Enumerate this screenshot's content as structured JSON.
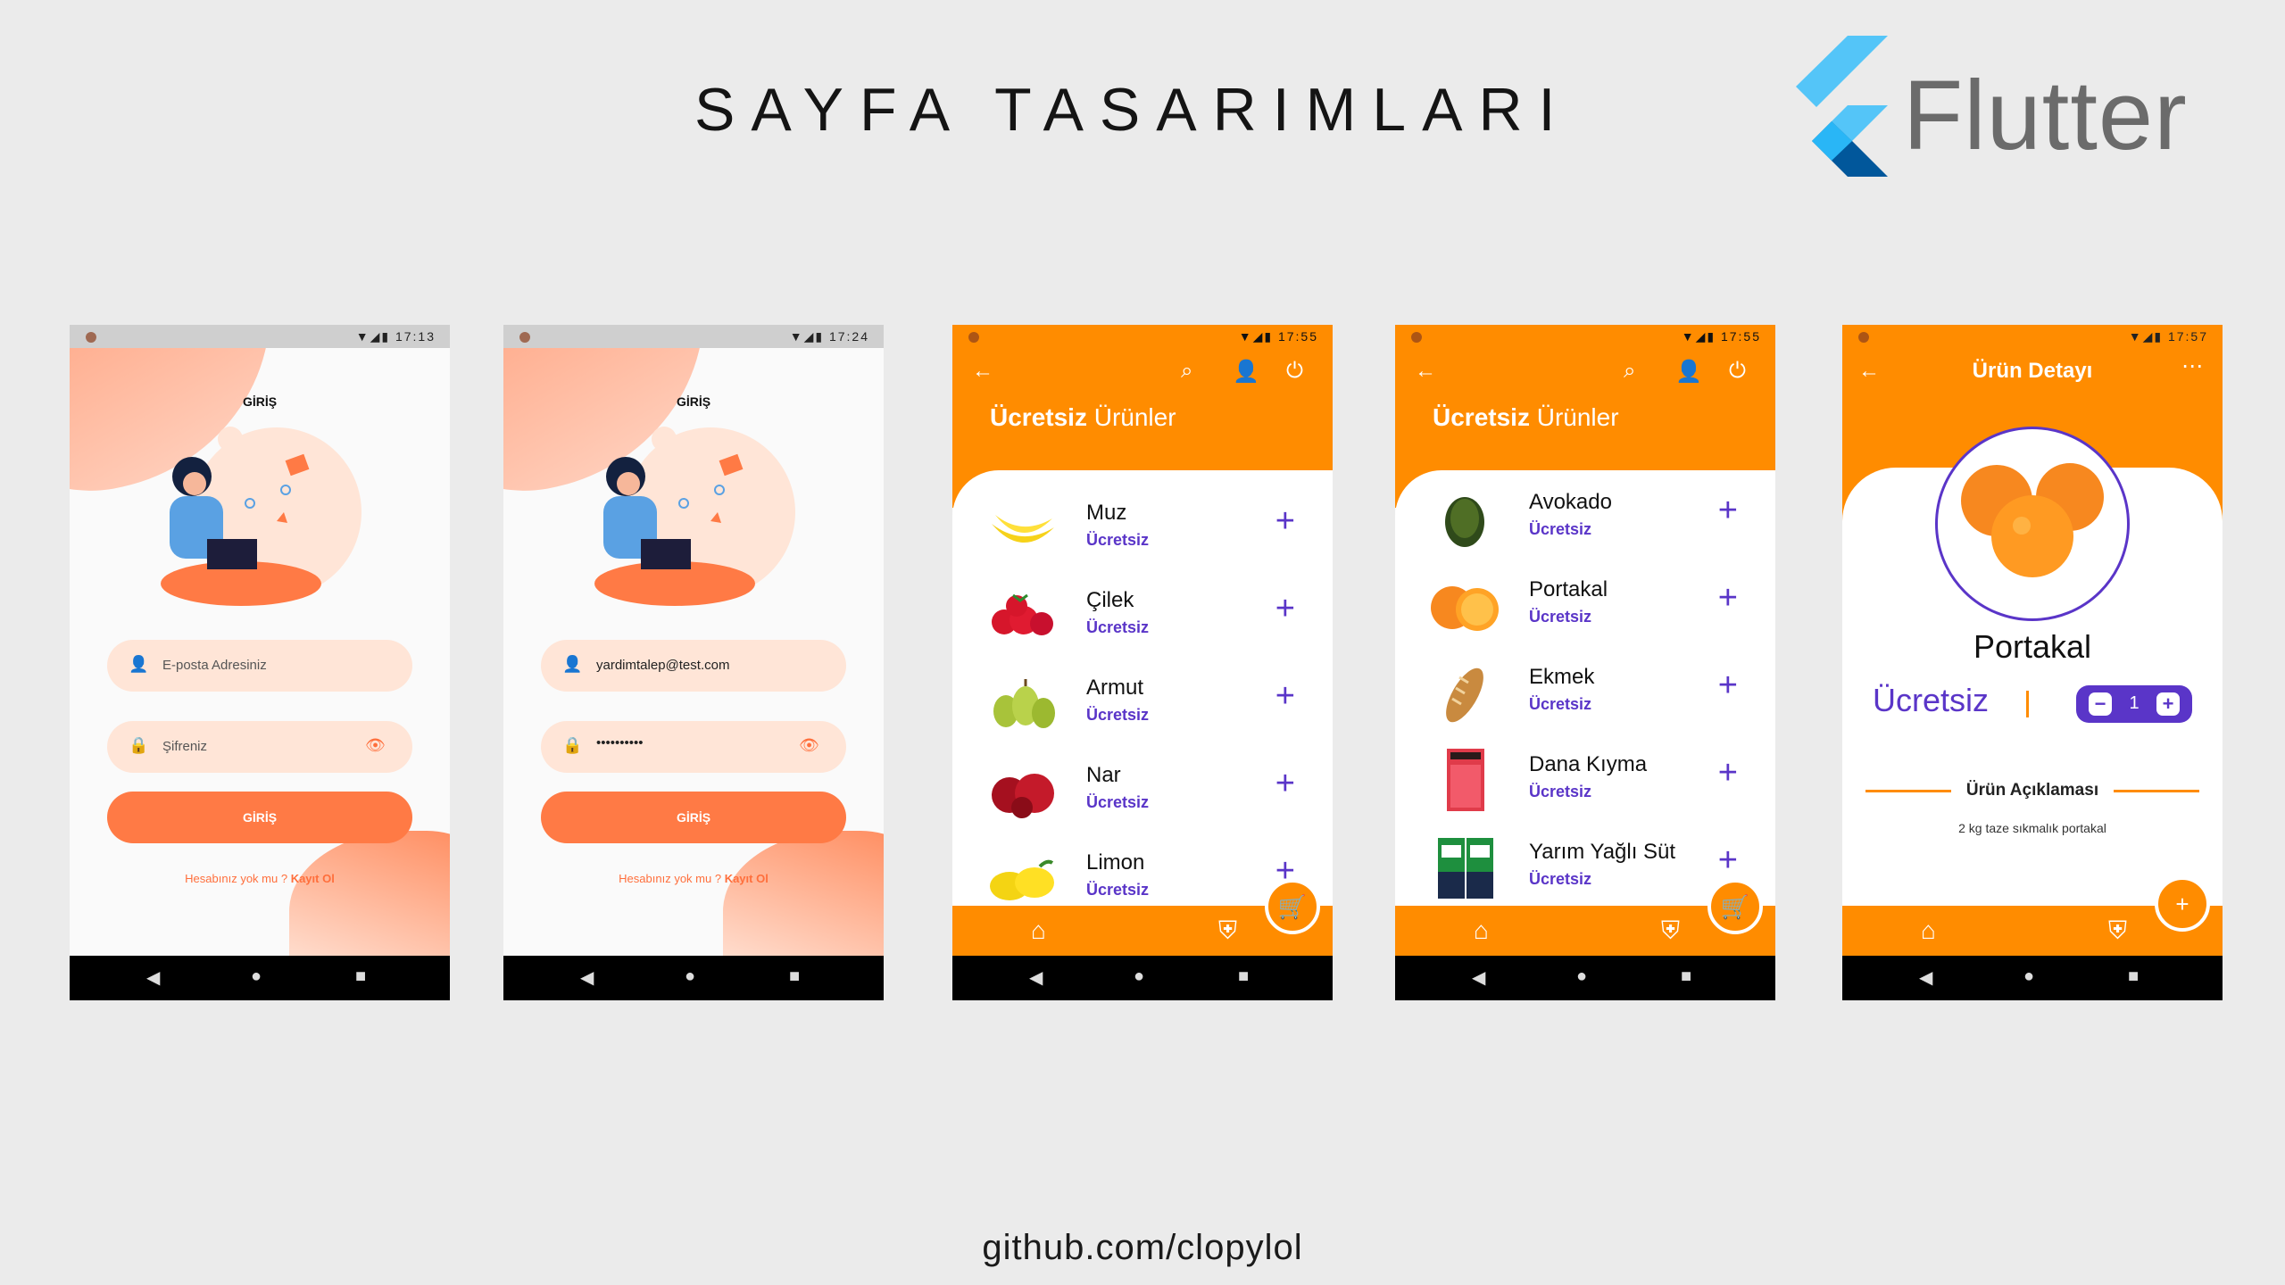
{
  "page_title": "SAYFA TASARIMLARI",
  "flutter_word": "Flutter",
  "footer_link": "github.com/clopylol",
  "colors": {
    "orange": "#ff8c00",
    "purple": "#5a35c8",
    "login_accent": "#ff7a45"
  },
  "login1": {
    "time": "17:13",
    "title": "GİRİŞ",
    "email_placeholder": "E-posta Adresiniz",
    "password_placeholder": "Şifreniz",
    "button": "GİRİŞ",
    "signup_prefix": "Hesabınız yok mu ?",
    "signup_link": "Kayıt Ol"
  },
  "login2": {
    "time": "17:24",
    "title": "GİRİŞ",
    "email_value": "yardimtalep@test.com",
    "password_value": "••••••••••",
    "button": "GİRİŞ",
    "signup_prefix": "Hesabınız yok mu ?",
    "signup_link": "Kayıt Ol"
  },
  "list1": {
    "time": "17:55",
    "title_bold": "Ücretsiz",
    "title_rest": "Ürünler",
    "items": [
      {
        "name": "Muz",
        "price": "Ücretsiz"
      },
      {
        "name": "Çilek",
        "price": "Ücretsiz"
      },
      {
        "name": "Armut",
        "price": "Ücretsiz"
      },
      {
        "name": "Nar",
        "price": "Ücretsiz"
      },
      {
        "name": "Limon",
        "price": "Ücretsiz"
      }
    ]
  },
  "list2": {
    "time": "17:55",
    "title_bold": "Ücretsiz",
    "title_rest": "Ürünler",
    "items": [
      {
        "name": "Avokado",
        "price": "Ücretsiz"
      },
      {
        "name": "Portakal",
        "price": "Ücretsiz"
      },
      {
        "name": "Ekmek",
        "price": "Ücretsiz"
      },
      {
        "name": "Dana Kıyma",
        "price": "Ücretsiz"
      },
      {
        "name": "Yarım Yağlı Süt",
        "price": "Ücretsiz"
      }
    ]
  },
  "detail": {
    "time": "17:57",
    "title": "Ürün Detayı",
    "name": "Portakal",
    "price": "Ücretsiz",
    "quantity": "1",
    "desc_title": "Ürün Açıklaması",
    "desc_text": "2 kg taze sıkmalık portakal"
  }
}
